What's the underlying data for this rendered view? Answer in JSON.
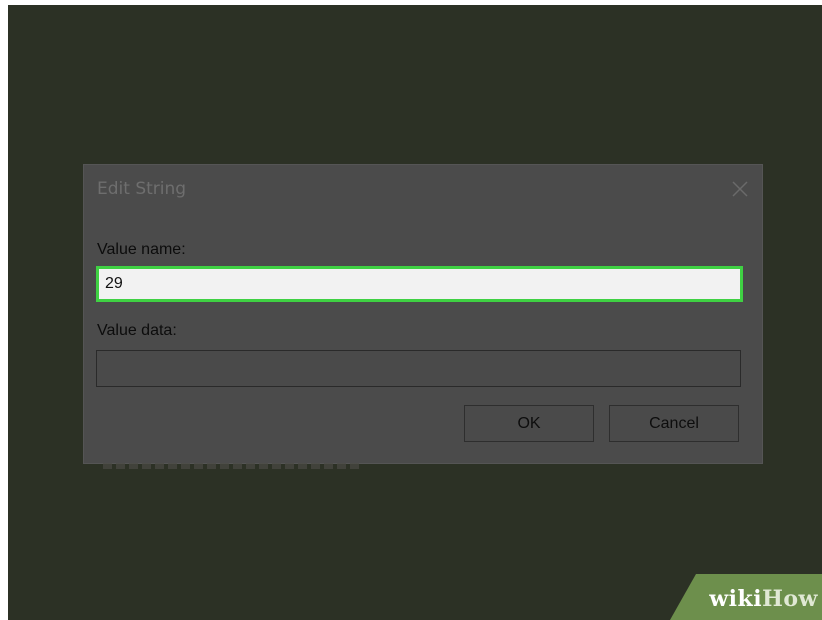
{
  "dialog": {
    "title": "Edit String",
    "value_name_label": "Value name:",
    "value_name": "29",
    "value_data_label": "Value data:",
    "value_data": "",
    "ok_label": "OK",
    "cancel_label": "Cancel",
    "close_icon": "close-icon"
  },
  "watermark": {
    "wiki": "wiki",
    "how": "How"
  },
  "colors": {
    "background": "#2c3125",
    "dialog": "#4b4b4b",
    "highlight": "#3fd143",
    "watermark": "#6d8f4c"
  }
}
